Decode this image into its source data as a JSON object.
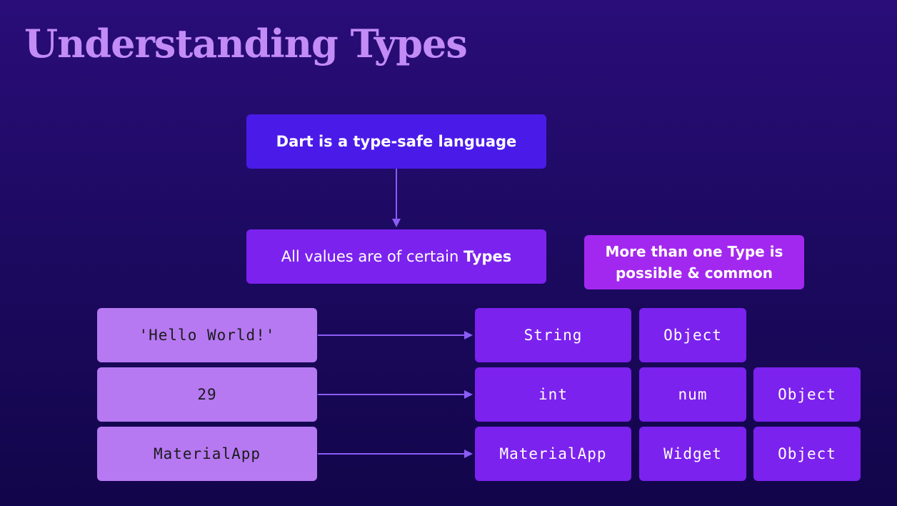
{
  "title": "Understanding Types",
  "top_box": "Dart is a type-safe language",
  "values_box": {
    "prefix": "All values are of certain ",
    "emphasis": "Types"
  },
  "note_box": "More than one Type is possible & common",
  "rows": [
    {
      "value": "'Hello World!'",
      "types": [
        "String",
        "Object"
      ]
    },
    {
      "value": "29",
      "types": [
        "int",
        "num",
        "Object"
      ]
    },
    {
      "value": "MaterialApp",
      "types": [
        "MaterialApp",
        "Widget",
        "Object"
      ]
    }
  ],
  "colors": {
    "title": "#c28bf6",
    "top_box": "#4a1ae8",
    "type_box": "#7b22ee",
    "note_box": "#a328ef",
    "value_box": "#b679f2",
    "arrow": "#8b5cf6"
  }
}
